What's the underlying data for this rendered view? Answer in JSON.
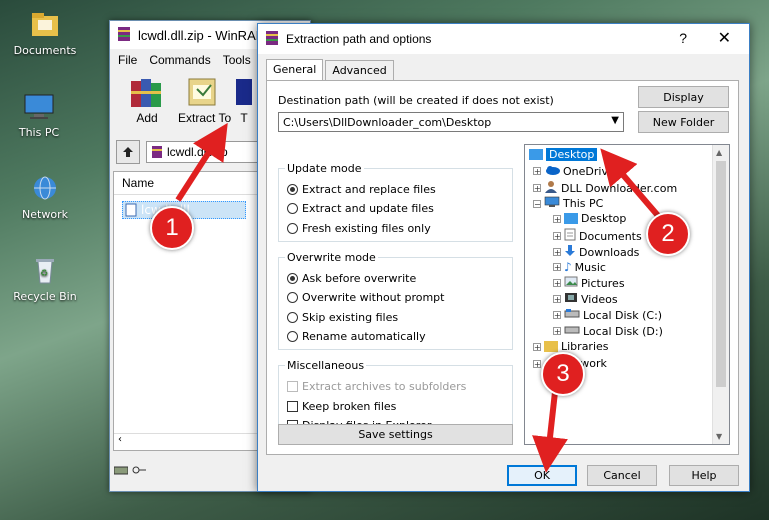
{
  "desktop": {
    "icons": [
      {
        "label": "Documents"
      },
      {
        "label": "This PC"
      },
      {
        "label": "Network"
      },
      {
        "label": "Recycle Bin"
      }
    ]
  },
  "winrar": {
    "title": "lcwdl.dll.zip - WinRAR",
    "menu": [
      "File",
      "Commands",
      "Tools"
    ],
    "toolbar": [
      {
        "label": "Add"
      },
      {
        "label": "Extract To"
      },
      {
        "label": "T"
      }
    ],
    "path": "lcwdl.dll.zip",
    "column_name": "Name",
    "selected_file": "lcwdl.dll"
  },
  "dialog": {
    "title": "Extraction path and options",
    "help": "?",
    "close": "✕",
    "tabs": [
      "General",
      "Advanced"
    ],
    "destination_label": "Destination path (will be created if does not exist)",
    "destination_value": "C:\\Users\\DllDownloader_com\\Desktop",
    "display_button": "Display",
    "new_folder_button": "New Folder",
    "update_mode": {
      "title": "Update mode",
      "options": [
        "Extract and replace files",
        "Extract and update files",
        "Fresh existing files only"
      ],
      "selected": 0
    },
    "overwrite_mode": {
      "title": "Overwrite mode",
      "options": [
        "Ask before overwrite",
        "Overwrite without prompt",
        "Skip existing files",
        "Rename automatically"
      ],
      "selected": 0
    },
    "misc": {
      "title": "Miscellaneous",
      "options": [
        "Extract archives to subfolders",
        "Keep broken files",
        "Display files in Explorer"
      ]
    },
    "save_settings": "Save settings",
    "tree": {
      "desktop": "Desktop",
      "onedrive": "OneDrive",
      "dll": "DLL Downloader.com",
      "thispc": "This PC",
      "children": [
        "Desktop",
        "Documents",
        "Downloads",
        "Music",
        "Pictures",
        "Videos",
        "Local Disk (C:)",
        "Local Disk (D:)"
      ],
      "libraries": "Libraries",
      "network": "Network"
    },
    "buttons": {
      "ok": "OK",
      "cancel": "Cancel",
      "help": "Help"
    }
  },
  "annotations": {
    "step1": "1",
    "step2": "2",
    "step3": "3",
    "color": "#e02020"
  }
}
